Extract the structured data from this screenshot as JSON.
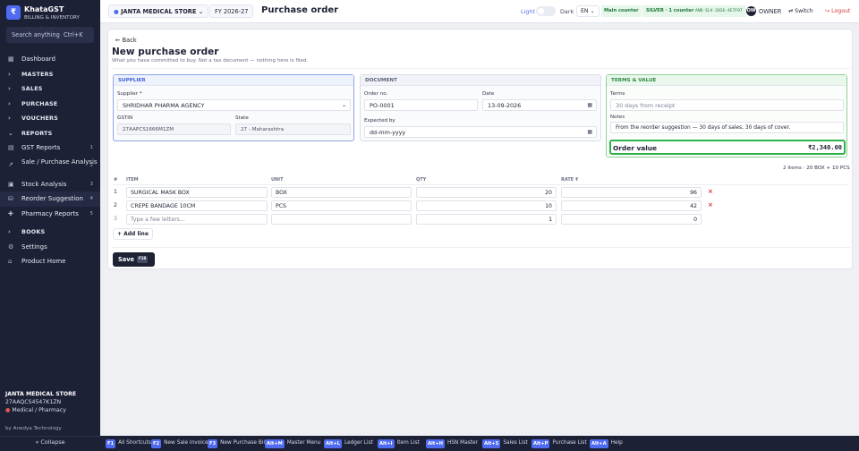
{
  "sidebar": {
    "logo_glyph": "₹",
    "app_name": "KhataGST",
    "app_subtitle": "BILLING & INVENTORY",
    "search_placeholder": "Search anything",
    "search_shortcut": "Ctrl+K",
    "items": [
      {
        "label": "Dashboard",
        "icon": "grid-icon",
        "count": ""
      },
      {
        "label": "MASTERS",
        "icon": "chevron-right-icon",
        "count": ""
      },
      {
        "label": "SALES",
        "icon": "chevron-right-icon",
        "count": ""
      },
      {
        "label": "PURCHASE",
        "icon": "chevron-right-icon",
        "count": ""
      },
      {
        "label": "VOUCHERS",
        "icon": "chevron-right-icon",
        "count": ""
      },
      {
        "label": "REPORTS",
        "icon": "chevron-down-icon",
        "count": ""
      },
      {
        "label": "GST Reports",
        "icon": "document-icon",
        "count": "1"
      },
      {
        "label": "Sale / Purchase Analysis",
        "icon": "trend-icon",
        "count": "2"
      },
      {
        "label": "Stock Analysis",
        "icon": "box-icon",
        "count": "3"
      },
      {
        "label": "Reorder Suggestion",
        "icon": "cart-icon",
        "count": "4"
      },
      {
        "label": "Pharmacy Reports",
        "icon": "pill-icon",
        "count": "5"
      },
      {
        "label": "BOOKS",
        "icon": "chevron-right-icon",
        "count": ""
      },
      {
        "label": "Settings",
        "icon": "gear-icon",
        "count": ""
      },
      {
        "label": "Product Home",
        "icon": "home-icon",
        "count": ""
      }
    ],
    "store_name": "JANTA MEDICAL STORE",
    "store_gstin": "27AAQCS4547K1ZN",
    "store_type": "Medical / Pharmacy",
    "by": "by Anedya Technology",
    "collapse_label": "« Collapse"
  },
  "topbar": {
    "store": "JANTA MEDICAL STORE",
    "fy": "FY 2026-27",
    "title": "Purchase order",
    "theme_light": "Light",
    "theme_dark": "Dark",
    "lang": "EN",
    "counter": "Main counter",
    "license_tier": "SILVER · 1 counter",
    "license_code": "AND-SLV-2026-4E7F97",
    "avatar": "OW",
    "user": "OWNER",
    "switch": "Switch",
    "logout": "Logout"
  },
  "page": {
    "back": "Back",
    "title": "New purchase order",
    "subtitle": "What you have committed to buy. Not a tax document — nothing here is filed."
  },
  "supplier": {
    "heading": "SUPPLIER",
    "supplier_label": "Supplier *",
    "supplier_value": "SHRIDHAR PHARMA AGENCY",
    "gstin_label": "GSTIN",
    "gstin_value": "27AAPCS1666M1ZM",
    "state_label": "State",
    "state_value": "27 - Maharashtra"
  },
  "document": {
    "heading": "DOCUMENT",
    "order_no_label": "Order no.",
    "order_no_value": "PO-0001",
    "date_label": "Date",
    "date_value": "13-09-2026",
    "expected_label": "Expected by",
    "expected_placeholder": "dd-mm-yyyy"
  },
  "terms": {
    "heading": "TERMS & VALUE",
    "terms_label": "Terms",
    "terms_placeholder": "30 days from receipt",
    "notes_label": "Notes",
    "notes_value": "From the reorder suggestion — 30 days of sales, 30 days of cover.",
    "order_value_label": "Order value",
    "order_value": "₹2,340.00"
  },
  "items": {
    "summary": "2 items · 20 BOX + 10 PCS",
    "columns": {
      "num": "#",
      "item": "ITEM",
      "unit": "UNIT",
      "qty": "QTY",
      "rate": "RATE ₹"
    },
    "rows": [
      {
        "num": "1",
        "item": "SURGICAL MASK BOX",
        "unit": "BOX",
        "qty": "20",
        "rate": "96"
      },
      {
        "num": "2",
        "item": "CREPE BANDAGE 10CM",
        "unit": "PCS",
        "qty": "10",
        "rate": "42"
      }
    ],
    "new_row": {
      "num": "3",
      "item_placeholder": "Type a few letters...",
      "qty": "1",
      "rate": "0"
    },
    "add_line": "+ Add line"
  },
  "actions": {
    "save": "Save",
    "save_key": "F10"
  },
  "shortcuts": [
    {
      "key": "F1",
      "label": "All Shortcuts"
    },
    {
      "key": "F2",
      "label": "New Sale Invoice"
    },
    {
      "key": "F3",
      "label": "New Purchase Bill"
    },
    {
      "key": "Alt+M",
      "label": "Master Menu"
    },
    {
      "key": "Alt+L",
      "label": "Ledger List"
    },
    {
      "key": "Alt+I",
      "label": "Item List"
    },
    {
      "key": "Alt+H",
      "label": "HSN Master"
    },
    {
      "key": "Alt+S",
      "label": "Sales List"
    },
    {
      "key": "Alt+P",
      "label": "Purchase List"
    },
    {
      "key": "Alt+A",
      "label": "Help"
    }
  ],
  "colors": {
    "sidebar_bg": "#1c2136",
    "accent": "#4f6bf1",
    "success": "#2fb34f",
    "danger": "#d63a3a"
  }
}
